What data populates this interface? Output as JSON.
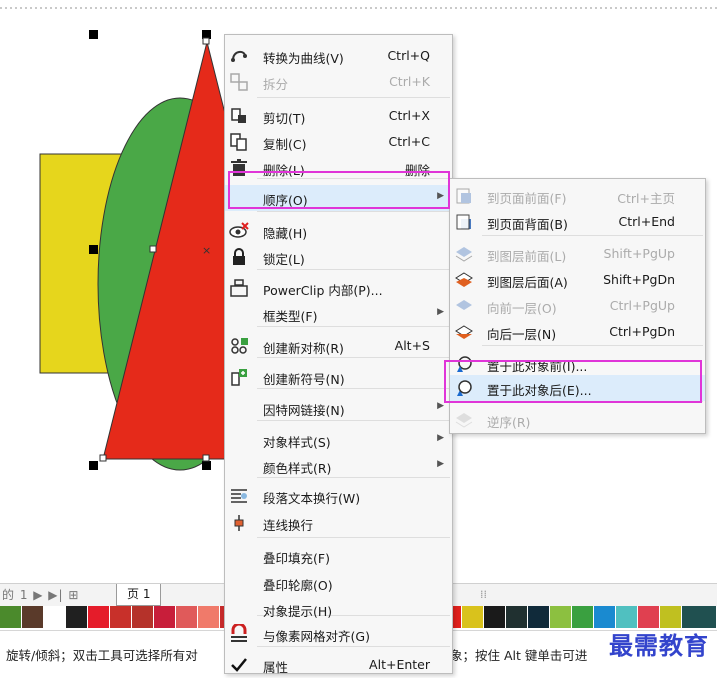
{
  "context_menu": {
    "items": [
      {
        "label": "转换为曲线(V)",
        "shortcut": "Ctrl+Q",
        "icon": "convert-curve-icon",
        "disabled": false,
        "submenu": false
      },
      {
        "label": "拆分",
        "shortcut": "Ctrl+K",
        "icon": "break-apart-icon",
        "disabled": true,
        "submenu": false
      },
      {
        "label": "剪切(T)",
        "shortcut": "Ctrl+X",
        "icon": "cut-icon",
        "disabled": false,
        "submenu": false
      },
      {
        "label": "复制(C)",
        "shortcut": "Ctrl+C",
        "icon": "copy-icon",
        "disabled": false,
        "submenu": false
      },
      {
        "label": "删除(L)",
        "shortcut": "删除",
        "icon": "trash-icon",
        "disabled": false,
        "submenu": false
      },
      {
        "label": "顺序(O)",
        "shortcut": "",
        "icon": "",
        "disabled": false,
        "submenu": true,
        "highlighted": true
      },
      {
        "label": "隐藏(H)",
        "shortcut": "",
        "icon": "hide-eye-icon",
        "disabled": false,
        "submenu": false
      },
      {
        "label": "锁定(L)",
        "shortcut": "",
        "icon": "lock-icon",
        "disabled": false,
        "submenu": false
      },
      {
        "label": "PowerClip 内部(P)...",
        "shortcut": "",
        "icon": "powerclip-icon",
        "disabled": false,
        "submenu": false
      },
      {
        "label": "框类型(F)",
        "shortcut": "",
        "icon": "",
        "disabled": false,
        "submenu": true
      },
      {
        "label": "创建新对称(R)",
        "shortcut": "Alt+S",
        "icon": "symmetry-icon",
        "disabled": false,
        "submenu": false
      },
      {
        "label": "创建新符号(N)",
        "shortcut": "",
        "icon": "new-symbol-icon",
        "disabled": false,
        "submenu": false
      },
      {
        "label": "因特网链接(N)",
        "shortcut": "",
        "icon": "",
        "disabled": false,
        "submenu": true
      },
      {
        "label": "对象样式(S)",
        "shortcut": "",
        "icon": "",
        "disabled": false,
        "submenu": true
      },
      {
        "label": "颜色样式(R)",
        "shortcut": "",
        "icon": "",
        "disabled": false,
        "submenu": true
      },
      {
        "label": "段落文本换行(W)",
        "shortcut": "",
        "icon": "paragraph-wrap-icon",
        "disabled": false,
        "submenu": false
      },
      {
        "label": "连线换行",
        "shortcut": "",
        "icon": "connector-wrap-icon",
        "disabled": false,
        "submenu": false
      },
      {
        "label": "叠印填充(F)",
        "shortcut": "",
        "icon": "",
        "disabled": false,
        "submenu": false
      },
      {
        "label": "叠印轮廓(O)",
        "shortcut": "",
        "icon": "",
        "disabled": false,
        "submenu": false
      },
      {
        "label": "对象提示(H)",
        "shortcut": "",
        "icon": "",
        "disabled": false,
        "submenu": false
      },
      {
        "label": "与像素网格对齐(G)",
        "shortcut": "",
        "icon": "magnet-icon",
        "disabled": false,
        "submenu": false
      },
      {
        "label": "属性",
        "shortcut": "Alt+Enter",
        "icon": "checkmark-icon",
        "disabled": false,
        "submenu": false
      }
    ]
  },
  "order_submenu": {
    "items": [
      {
        "label": "到页面前面(F)",
        "shortcut": "Ctrl+主页",
        "icon": "to-page-front-icon",
        "disabled": true
      },
      {
        "label": "到页面背面(B)",
        "shortcut": "Ctrl+End",
        "icon": "to-page-back-icon",
        "disabled": false
      },
      {
        "label": "到图层前面(L)",
        "shortcut": "Shift+PgUp",
        "icon": "to-layer-front-icon",
        "disabled": true
      },
      {
        "label": "到图层后面(A)",
        "shortcut": "Shift+PgDn",
        "icon": "to-layer-back-icon",
        "disabled": false
      },
      {
        "label": "向前一层(O)",
        "shortcut": "Ctrl+PgUp",
        "icon": "forward-one-icon",
        "disabled": true
      },
      {
        "label": "向后一层(N)",
        "shortcut": "Ctrl+PgDn",
        "icon": "back-one-icon",
        "disabled": false
      },
      {
        "label": "置于此对象前(I)...",
        "shortcut": "",
        "icon": "in-front-of-icon",
        "disabled": false
      },
      {
        "label": "置于此对象后(E)...",
        "shortcut": "",
        "icon": "behind-icon",
        "disabled": false,
        "highlighted": true
      },
      {
        "label": "逆序(R)",
        "shortcut": "",
        "icon": "reverse-order-icon",
        "disabled": true
      }
    ]
  },
  "page_bar": {
    "nav_text": "的 1 ▶ ▶| ⊞",
    "page_tab": "页 1"
  },
  "status_bar": {
    "left_text": "旋转/倾斜；双击工具可选择所有对",
    "right_text": "象；按住 Alt 键单击可进"
  },
  "watermark": "最需教育",
  "palette": [
    "#4b8a2c",
    "#5a3a2a",
    "#ffffff",
    "#202020",
    "#e51c2a",
    "#c8302a",
    "#b5322a",
    "#c81e3a",
    "#e05a5a",
    "#f07a6a",
    "#c62a2a",
    "#6a1a1a",
    "#8a2a3a",
    "#a05050",
    "#cc3030",
    "#e86060",
    "#ffb0a0",
    "#b02020",
    "#7a3030",
    "#d04040",
    "#e2201c",
    "#d9c21c",
    "#1a1a1a",
    "#203030",
    "#102a3a",
    "#8cc040",
    "#3aa040",
    "#1a8ad0",
    "#50c0c0",
    "#e04050",
    "#c0c020",
    "#205050"
  ],
  "colors": {
    "menu_bg": "#f7f7f7",
    "highlight": "#dcecfb",
    "callout": "#e035d8",
    "shape_yellow": "#e6d61c",
    "shape_green": "#4aa847",
    "shape_red": "#e52a1a"
  }
}
